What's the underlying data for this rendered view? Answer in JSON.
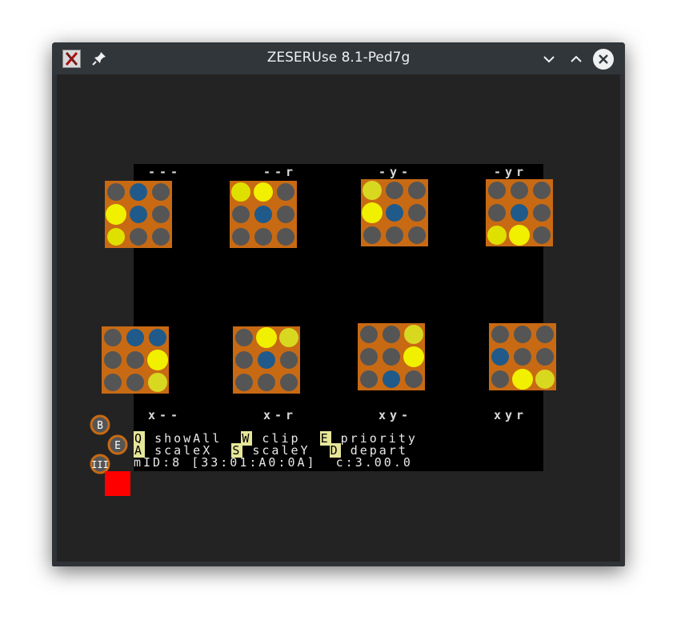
{
  "window": {
    "title": "ZESERUse 8.1-Ped7g",
    "app_icon_glyph": "X"
  },
  "labels_top": [
    "---",
    "--r",
    "-y-",
    "-yr"
  ],
  "labels_bottom": [
    "x--",
    "x-r",
    "xy-",
    "xyr"
  ],
  "controls": {
    "q_key": "Q",
    "q_label": "showAll",
    "w_key": "W",
    "w_label": "clip",
    "e_key": "E",
    "e_label": "priority",
    "a_key": "A",
    "a_label": "scaleX",
    "s_key": "S",
    "s_label": "scaleY",
    "d_key": "D",
    "d_label": "depart"
  },
  "status": {
    "mid": "mID:8",
    "regs": "[33:01:A0:0A]",
    "c": "c:3.00.0"
  },
  "mini_sprites": [
    "B",
    "E",
    "III"
  ],
  "colors": {
    "red_marker": "#ff0000",
    "key_highlight": "#e6e69a"
  }
}
